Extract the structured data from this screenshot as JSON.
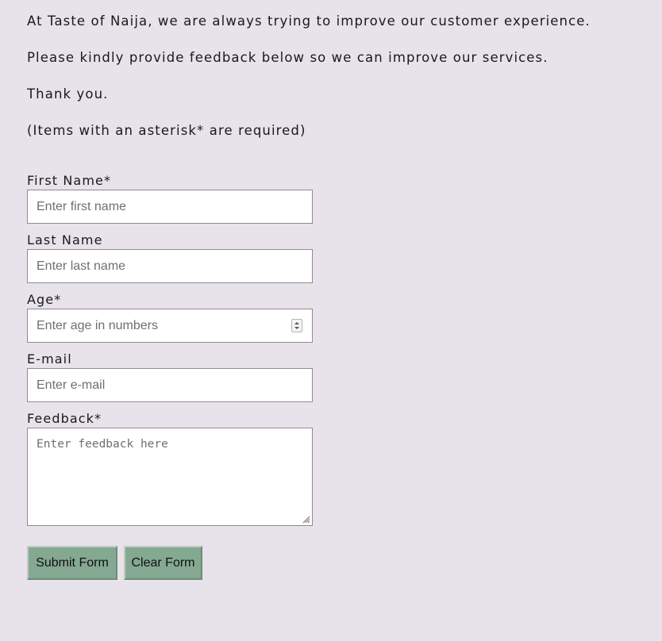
{
  "intro": {
    "line1": "At Taste of Naija, we are always trying to improve our customer experience.",
    "line2": "Please kindly provide feedback below so we can improve our services.",
    "line3": "Thank you.",
    "line4": "(Items with an asterisk* are required)"
  },
  "form": {
    "first_name": {
      "label": "First Name*",
      "placeholder": "Enter first name",
      "value": ""
    },
    "last_name": {
      "label": "Last Name",
      "placeholder": "Enter last name",
      "value": ""
    },
    "age": {
      "label": "Age*",
      "placeholder": "Enter age in numbers",
      "value": ""
    },
    "email": {
      "label": "E-mail",
      "placeholder": "Enter e-mail",
      "value": ""
    },
    "feedback": {
      "label": "Feedback*",
      "placeholder": "Enter feedback here",
      "value": ""
    },
    "submit_label": "Submit Form",
    "clear_label": "Clear Form"
  },
  "colors": {
    "background": "#e8e2ea",
    "button": "#85a892"
  }
}
